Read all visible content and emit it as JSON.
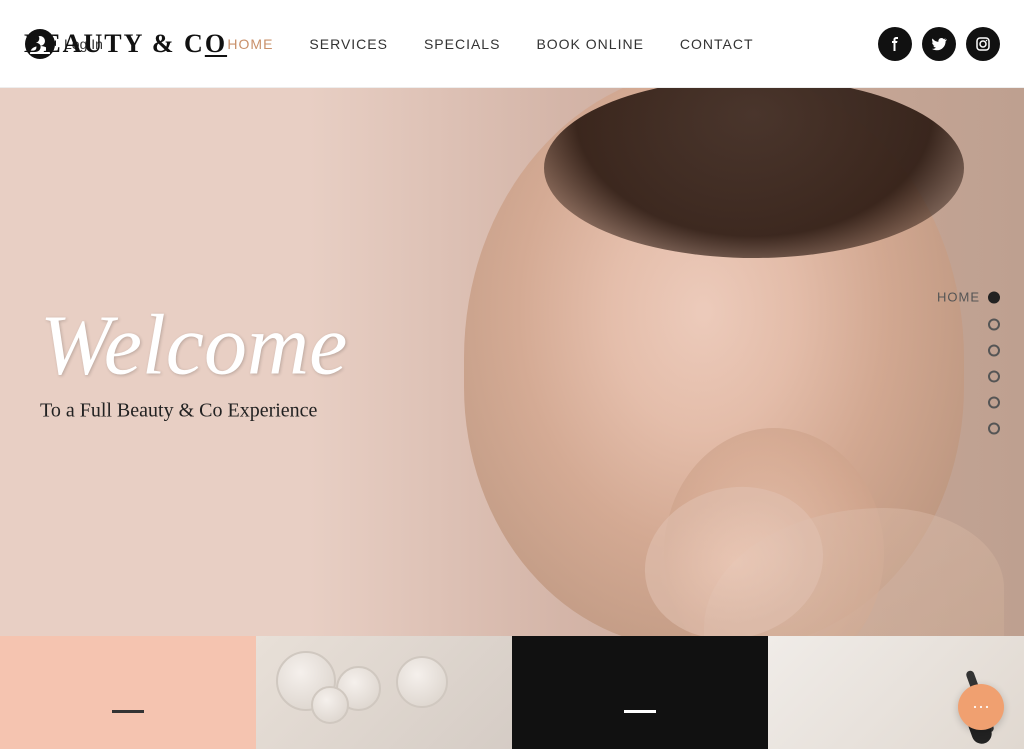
{
  "header": {
    "logo": "BEAUTY & C",
    "logo_special": "o",
    "login_label": "Log In",
    "nav": [
      {
        "id": "home",
        "label": "HOME",
        "active": true
      },
      {
        "id": "services",
        "label": "SERVICES",
        "active": false
      },
      {
        "id": "specials",
        "label": "SPECIALS",
        "active": false
      },
      {
        "id": "book_online",
        "label": "BOOK ONLINE",
        "active": false
      },
      {
        "id": "contact",
        "label": "CONTACT",
        "active": false
      }
    ],
    "social": [
      {
        "id": "facebook",
        "icon": "f"
      },
      {
        "id": "twitter",
        "icon": "t"
      },
      {
        "id": "instagram",
        "icon": "◻"
      }
    ]
  },
  "hero": {
    "welcome_text": "Welcome",
    "subtitle": "To a Full Beauty & Co Experience",
    "side_nav_label": "HOME"
  },
  "side_dots": [
    {
      "id": "dot1",
      "filled": true
    },
    {
      "id": "dot2",
      "filled": false
    },
    {
      "id": "dot3",
      "filled": false
    },
    {
      "id": "dot4",
      "filled": false
    },
    {
      "id": "dot5",
      "filled": false
    },
    {
      "id": "dot6",
      "filled": false
    }
  ],
  "chat": {
    "icon": "···"
  }
}
